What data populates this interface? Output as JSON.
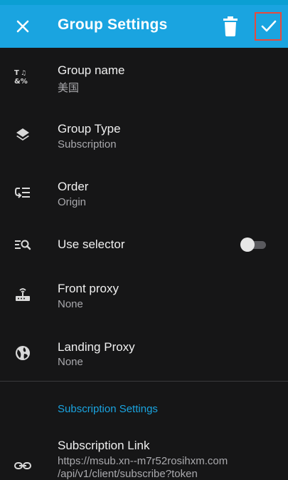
{
  "appbar": {
    "title": "Group Settings",
    "close_icon": "close-icon",
    "delete_icon": "trash-icon",
    "confirm_icon": "check-icon",
    "color": "#1aa4e0"
  },
  "rows": [
    {
      "icon": "translate-text-icon",
      "label": "Group name",
      "value": "美国"
    },
    {
      "icon": "layers-icon",
      "label": "Group Type",
      "value": "Subscription"
    },
    {
      "icon": "order-list-icon",
      "label": "Order",
      "value": "Origin"
    },
    {
      "icon": "list-search-icon",
      "label": "Use selector",
      "toggle": false
    },
    {
      "icon": "router-icon",
      "label": "Front proxy",
      "value": "None"
    },
    {
      "icon": "globe-icon",
      "label": "Landing Proxy",
      "value": "None"
    }
  ],
  "section": {
    "title": "Subscription Settings",
    "link_label": "Subscription Link",
    "link_value": "https://msub.xn--m7r52rosihxm.com",
    "link_value_2": "/api/v1/client/subscribe?token",
    "link_icon": "link-icon"
  }
}
